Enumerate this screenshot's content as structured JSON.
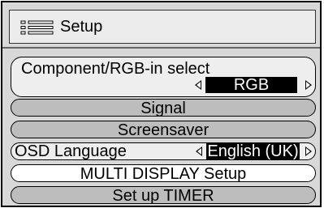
{
  "header": {
    "icon": "list-menu-icon",
    "title": "Setup"
  },
  "items": {
    "component_rgb": {
      "label": "Component/RGB-in  select",
      "value": "RGB"
    },
    "signal": {
      "label": "Signal"
    },
    "screensaver": {
      "label": "Screensaver"
    },
    "osd_language": {
      "label": "OSD  Language",
      "value": "English (UK)"
    },
    "multi_display": {
      "label": "MULTI DISPLAY Setup"
    },
    "timer": {
      "label": "Set up TIMER"
    }
  },
  "colors": {
    "frame_background": "#d8d8d8",
    "header_background": "#ebebeb",
    "item_grey": "#bdbdbd",
    "item_light": "#eeeeee",
    "item_highlight": "#ffffff",
    "value_background": "#000000",
    "value_text": "#ffffff"
  }
}
